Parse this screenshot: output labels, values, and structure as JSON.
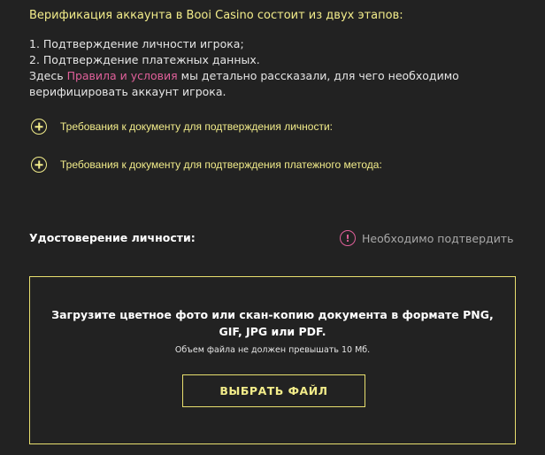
{
  "intro": {
    "title": "Верификация аккаунта в Booi Casino состоит из двух этапов:",
    "step1": "1. Подтверждение личности игрока;",
    "step2": "2. Подтверждение платежных данных.",
    "details_prefix": "Здесь ",
    "details_link": "Правила и условия",
    "details_suffix_line1": " мы детально рассказали, для чего необходимо",
    "details_suffix_line2": "верифицировать аккаунт игрока."
  },
  "accordions": [
    {
      "label": "Требования к документу для подтверждения личности:",
      "icon": "plus-circle-icon"
    },
    {
      "label": "Требования к документу для подтверждения платежного метода:",
      "icon": "plus-circle-icon"
    }
  ],
  "identity": {
    "label": "Удостоверение личности:",
    "status_icon": "exclamation-circle-icon",
    "status_text": "Необходимо подтвердить"
  },
  "upload": {
    "instructions": "Загрузите цветное фото или скан-копию документа в формате PNG, GIF, JPG или PDF.",
    "note": "Объем файла не должен превышать 10 Мб.",
    "button_label": "ВЫБРАТЬ ФАЙЛ"
  },
  "colors": {
    "background": "#222222",
    "accent_yellow": "#f2ec8a",
    "link_pink": "#e0609a",
    "muted_text": "#a8a8a8"
  }
}
